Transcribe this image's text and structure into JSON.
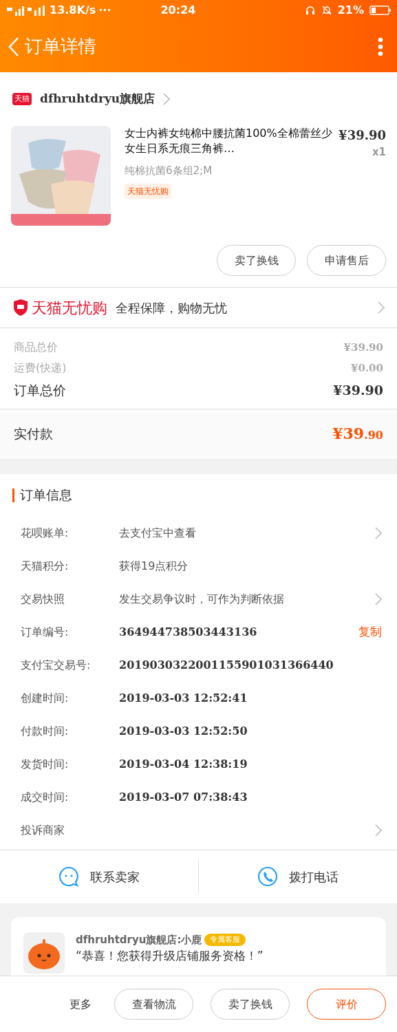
{
  "status_bar": {
    "network": "13.8K/s",
    "more": "···",
    "time": "20:24",
    "battery": "21%"
  },
  "header": {
    "title": "订单详情"
  },
  "store": {
    "badge": "天猫",
    "name": "dfhruhtdryu旗舰店"
  },
  "product": {
    "title": "女士内裤女纯棉中腰抗菌100%全棉蕾丝少女生日系无痕三角裤…",
    "price": "¥39.90",
    "quantity": "x1",
    "variant": "纯棉抗菌6条组2;M",
    "tag": "天猫无忧购"
  },
  "item_actions": [
    "卖了换钱",
    "申请售后"
  ],
  "guarantee": {
    "logo": "天猫无忧购",
    "text": "全程保障，购物无忧"
  },
  "totals": [
    {
      "kind": "minor",
      "label": "商品总价",
      "value": "¥39.90"
    },
    {
      "kind": "minor",
      "label": "运费(快递)",
      "value": "¥0.00"
    },
    {
      "kind": "major",
      "label": "订单总价",
      "value": "¥39.90"
    }
  ],
  "paid": {
    "label": "实付款",
    "value": "¥39",
    "decimals": ".90"
  },
  "order_info": {
    "title": "订单信息",
    "rows": [
      {
        "label": "花呗账单:",
        "value": "去支付宝中查看",
        "kind": "link"
      },
      {
        "label": "天猫积分:",
        "value": "获得19点积分",
        "kind": "plain"
      },
      {
        "label": "交易快照",
        "value": "发生交易争议时，可作为判断依据",
        "kind": "link"
      },
      {
        "label": "订单编号:",
        "value": "364944738503443136",
        "kind": "copy",
        "action": "复制"
      },
      {
        "label": "支付宝交易号:",
        "value": "2019030322001155901031366440",
        "kind": "plain"
      },
      {
        "label": "创建时间:",
        "value": "2019-03-03 12:52:41",
        "kind": "plain"
      },
      {
        "label": "付款时间:",
        "value": "2019-03-03 12:52:50",
        "kind": "plain"
      },
      {
        "label": "发货时间:",
        "value": "2019-03-04 12:38:19",
        "kind": "plain"
      },
      {
        "label": "成交时间:",
        "value": "2019-03-07 07:38:43",
        "kind": "plain"
      },
      {
        "label": "投诉商家",
        "kind": "link"
      }
    ]
  },
  "contact": [
    {
      "kind": "chat",
      "label": "联系卖家"
    },
    {
      "kind": "phone",
      "label": "拨打电话"
    }
  ],
  "message": {
    "sender": "dfhruhtdryu旗舰店:小鹿",
    "badge": "专属客服",
    "text": "“恭喜！您获得升级店铺服务资格！”"
  },
  "bottom_bar": [
    {
      "kind": "text",
      "label": "更多"
    },
    {
      "kind": "outline",
      "label": "查看物流"
    },
    {
      "kind": "outline",
      "label": "卖了换钱"
    },
    {
      "kind": "accent",
      "label": "评价"
    }
  ]
}
